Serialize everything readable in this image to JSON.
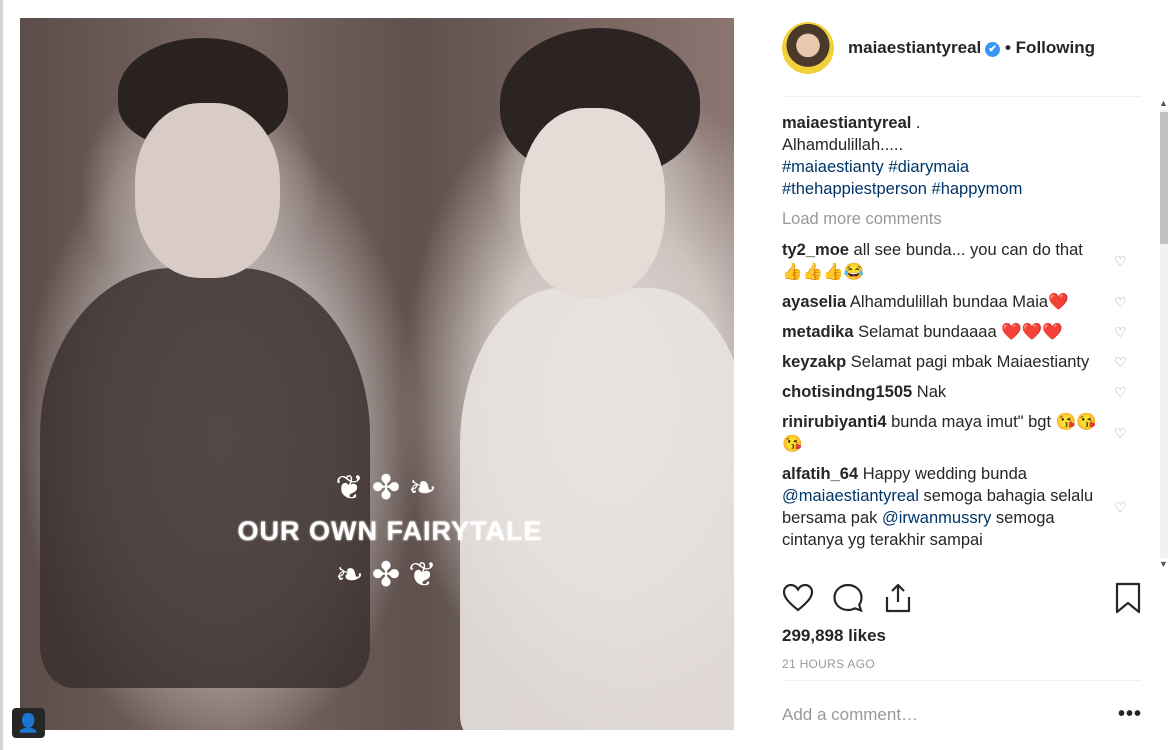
{
  "post": {
    "image_text": "OUR OWN FAIRYTALE",
    "user_tag_icon": "user-icon"
  },
  "header": {
    "username": "maiaestiantyreal",
    "verified": "✔",
    "separator": "•",
    "following": "Following"
  },
  "caption": {
    "username": "maiaestiantyreal",
    "line1": " .",
    "line2": "Alhamdulillah.....",
    "tags1": "#maiaestianty #diarymaia",
    "tags2": "#thehappiestperson #happymom"
  },
  "load_more": "Load more comments",
  "comments": [
    {
      "user": "ty2_moe",
      "text": " all see bunda... you can do that👍👍👍😂"
    },
    {
      "user": "ayaselia",
      "text": " Alhamdulillah bundaa Maia❤️"
    },
    {
      "user": "metadika",
      "text": " Selamat bundaaaa ❤️❤️❤️"
    },
    {
      "user": "keyzakp",
      "text": " Selamat pagi mbak Maiaestianty"
    },
    {
      "user": "chotisindng1505",
      "text": " Nak"
    },
    {
      "user": "rinirubiyanti4",
      "text": " bunda maya imut\" bgt 😘😘😘"
    },
    {
      "user": "alfatih_64",
      "text": " Happy wedding bunda ",
      "mention1": "@maiaestiantyreal",
      "text2": " semoga bahagia selalu bersama pak ",
      "mention2": "@irwanmussry",
      "text3": " semoga cintanya yg terakhir sampai"
    }
  ],
  "likes": "299,898 likes",
  "time": "21 HOURS AGO",
  "add_comment": {
    "placeholder": "Add a comment…"
  },
  "more": "•••",
  "colors": {
    "link": "#003569",
    "muted": "#999999",
    "verified": "#3897f0"
  }
}
